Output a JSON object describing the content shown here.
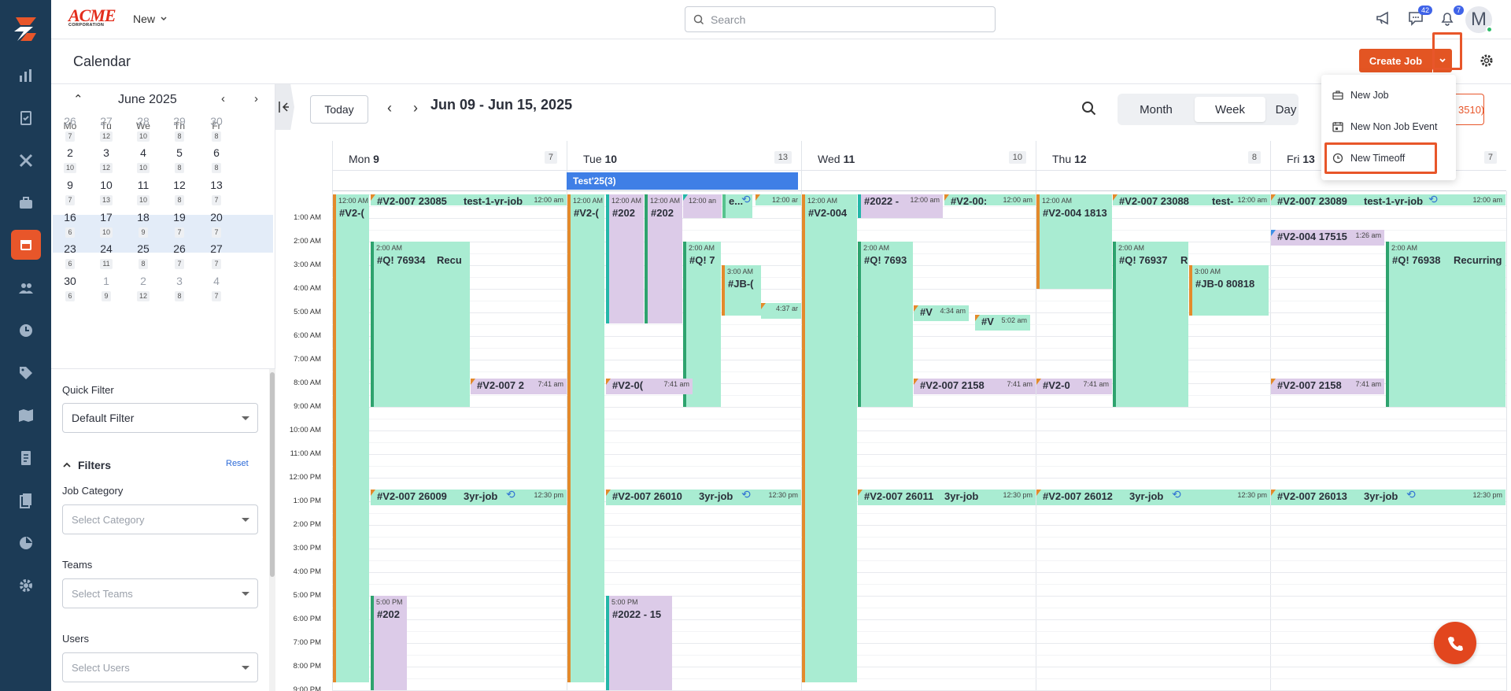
{
  "app": {
    "brand_line1": "ACME",
    "brand_line2": "CORPORATION",
    "new_label": "New",
    "search_placeholder": "Search",
    "chat_badge": "42",
    "notif_badge": "7",
    "avatar_letter": "M"
  },
  "page": {
    "title": "Calendar",
    "create_job_label": "Create Job"
  },
  "dropdown": {
    "items": [
      "New Job",
      "New Non Job Event",
      "New Timeoff"
    ]
  },
  "mini_calendar": {
    "title": "June 2025",
    "weekdays": [
      "Mo",
      "Tu",
      "We",
      "Th",
      "Fr"
    ],
    "weeks": [
      [
        {
          "d": "26",
          "c": "7"
        },
        {
          "d": "27",
          "c": "12"
        },
        {
          "d": "28",
          "c": "10"
        },
        {
          "d": "29",
          "c": "8"
        },
        {
          "d": "30",
          "c": "8"
        }
      ],
      [
        {
          "d": "2",
          "c": "10"
        },
        {
          "d": "3",
          "c": "12"
        },
        {
          "d": "4",
          "c": "10"
        },
        {
          "d": "5",
          "c": "8"
        },
        {
          "d": "6",
          "c": "8"
        }
      ],
      [
        {
          "d": "9",
          "c": "7"
        },
        {
          "d": "10",
          "c": "13"
        },
        {
          "d": "11",
          "c": "10"
        },
        {
          "d": "12",
          "c": "8"
        },
        {
          "d": "13",
          "c": "7"
        }
      ],
      [
        {
          "d": "16",
          "c": "6"
        },
        {
          "d": "17",
          "c": "10"
        },
        {
          "d": "18",
          "c": "9"
        },
        {
          "d": "19",
          "c": "7"
        },
        {
          "d": "20",
          "c": "7"
        }
      ],
      [
        {
          "d": "23",
          "c": "6"
        },
        {
          "d": "24",
          "c": "11"
        },
        {
          "d": "25",
          "c": "8"
        },
        {
          "d": "26",
          "c": "7"
        },
        {
          "d": "27",
          "c": "7"
        }
      ],
      [
        {
          "d": "30",
          "c": "6"
        },
        {
          "d": "1",
          "c": "9"
        },
        {
          "d": "2",
          "c": "12"
        },
        {
          "d": "3",
          "c": "8"
        },
        {
          "d": "4",
          "c": "7"
        }
      ]
    ]
  },
  "filters": {
    "quick_filter_label": "Quick Filter",
    "quick_filter_value": "Default Filter",
    "filters_title": "Filters",
    "reset_label": "Reset",
    "job_category_label": "Job Category",
    "job_category_placeholder": "Select Category",
    "teams_label": "Teams",
    "teams_placeholder": "Select Teams",
    "users_label": "Users",
    "users_placeholder": "Select Users"
  },
  "calendar": {
    "today_label": "Today",
    "range": "Jun 09 - Jun 15, 2025",
    "views": [
      "Month",
      "Week",
      "Day"
    ],
    "active_view": "Week",
    "partial_button": "3510)",
    "days": [
      {
        "name": "Mon",
        "num": "9",
        "count": "7"
      },
      {
        "name": "Tue",
        "num": "10",
        "count": "13"
      },
      {
        "name": "Wed",
        "num": "11",
        "count": "10"
      },
      {
        "name": "Thu",
        "num": "12",
        "count": "8"
      },
      {
        "name": "Fri",
        "num": "13",
        "count": "7"
      }
    ],
    "allday_event": "Test'25(3)",
    "times": [
      "1:00 AM",
      "2:00 AM",
      "3:00 AM",
      "4:00 AM",
      "5:00 AM",
      "6:00 AM",
      "7:00 AM",
      "8:00 AM",
      "9:00 AM",
      "10:00 AM",
      "11:00 AM",
      "12:00 PM",
      "1:00 PM",
      "2:00 PM",
      "3:00 PM",
      "4:00 PM",
      "5:00 PM",
      "6:00 PM",
      "7:00 PM",
      "8:00 PM",
      "9:00 PM"
    ],
    "events": {
      "mon_a_time": "12:00 AM",
      "mon_a_title": "#V2-(",
      "mon_b_title": "#V2-007 23085",
      "mon_b_sub": "test-1-yr-job",
      "mon_b_time": "12:00 am",
      "mon_c_time": "2:00 AM",
      "mon_c_title": "#Q! 76934",
      "mon_c_sub": "Recu",
      "mon_d_title": "#V2-007 2",
      "mon_d_time": "7:41 am",
      "mon_e_title": "#V2-007 26009",
      "mon_e_sub": "3yr-job",
      "mon_e_time": "12:30 pm",
      "mon_f_time": "5:00 PM",
      "mon_f_title": "#202",
      "tue_a_time": "12:00 AM",
      "tue_a_title": "#V2-(",
      "tue_b_time": "12:00 AM",
      "tue_b_title": "#202",
      "tue_c_time": "12:00 AM",
      "tue_c_title": "#202",
      "tue_d_time": "12:00 an",
      "tue_e_title": "e...",
      "tue_f_time": "12:00 ar",
      "tue_g_time": "2:00 AM",
      "tue_g_title": "#Q! 7",
      "tue_h_time": "3:00 AM",
      "tue_h_title": "#JB-(",
      "tue_i_time": "4:37 ar",
      "tue_j_title": "#V2-0(",
      "tue_j_time": "7:41 am",
      "tue_k_title": "#V2-007 26010",
      "tue_k_sub": "3yr-job",
      "tue_k_time": "12:30 pm",
      "tue_l_time": "5:00 PM",
      "tue_l_title": "#2022 - 15",
      "wed_a_time": "12:00 AM",
      "wed_a_title": "#V2-004",
      "wed_b_title": "#2022 -",
      "wed_b_time": "12:00 am",
      "wed_c_title": "#V2-00:",
      "wed_c_time": "12:00 am",
      "wed_d_time": "2:00 AM",
      "wed_d_title": "#Q! 7693",
      "wed_e_title": "#V",
      "wed_e_time": "4:34 am",
      "wed_f_title": "#V",
      "wed_f_time": "5:02 am",
      "wed_g_title": "#V2-007 2158",
      "wed_g_time": "7:41 am",
      "wed_h_title": "#V2-007 26011",
      "wed_h_sub": "3yr-job",
      "wed_h_time": "12:30 pm",
      "thu_a_time": "12:00 AM",
      "thu_a_title": "#V2-004 1813",
      "thu_b_title": "#V2-007 23088",
      "thu_b_sub": "test-",
      "thu_b_time": "12:00 am",
      "thu_c_time": "2:00 AM",
      "thu_c_title": "#Q! 76937",
      "thu_c_sub": "R",
      "thu_d_time": "3:00 AM",
      "thu_d_title": "#JB-0 80818",
      "thu_e_title": "#V2-0",
      "thu_e_time": "7:41 am",
      "thu_f_title": "#V2-007 26012",
      "thu_f_sub": "3yr-job",
      "thu_f_time": "12:30 pm",
      "fri_a_title": "#V2-007 23089",
      "fri_a_sub": "test-1-yr-job",
      "fri_a_time": "12:00 am",
      "fri_b_title": "#V2-004 17515",
      "fri_b_time": "1:26 am",
      "fri_c_time": "2:00 AM",
      "fri_c_title": "#Q! 76938",
      "fri_c_sub": "Recurring",
      "fri_d_title": "#V2-007 2158",
      "fri_d_time": "7:41 am",
      "fri_e_title": "#V2-007 26013",
      "fri_e_sub": "3yr-job",
      "fri_e_time": "12:30 pm"
    }
  },
  "colors": {
    "accent": "#e35523",
    "rail": "#1c3b56",
    "event_green": "#a9ecd2",
    "event_purple": "#dccbe8",
    "allday_blue": "#3f7fe6",
    "highlight": "#e8562a"
  }
}
